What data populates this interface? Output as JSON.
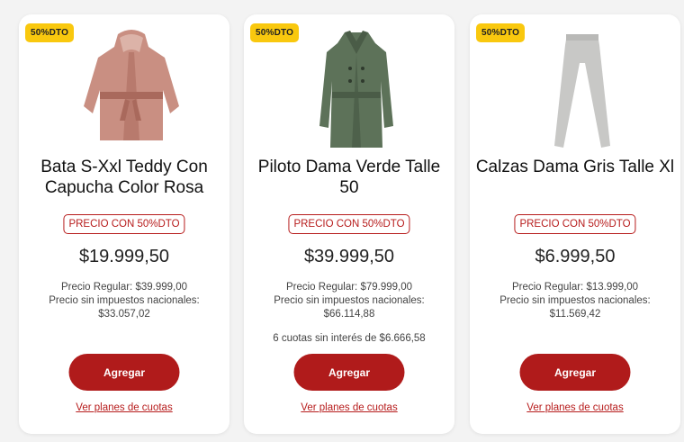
{
  "colors": {
    "accent": "#b01b1b",
    "badge": "#f9c80e",
    "card": "#ffffff"
  },
  "products": [
    {
      "badge": "50%DTO",
      "image_icon": "bathrobe-image",
      "title": "Bata S-Xxl Teddy Con Capucha Color Rosa",
      "promo_label": "PRECIO CON 50%DTO",
      "price": "$19.999,50",
      "regular_price": "Precio Regular: $39.999,00",
      "tax_free_label": "Precio sin impuestos nacionales:",
      "tax_free_value": "$33.057,02",
      "installments": "",
      "add_button": "Agregar",
      "plans_link": "Ver planes de cuotas"
    },
    {
      "badge": "50%DTO",
      "image_icon": "trench-coat-image",
      "title": "Piloto Dama Verde Talle 50",
      "promo_label": "PRECIO CON 50%DTO",
      "price": "$39.999,50",
      "regular_price": "Precio Regular: $79.999,00",
      "tax_free_label": "Precio sin impuestos nacionales:",
      "tax_free_value": "$66.114,88",
      "installments": "6 cuotas sin interés de $6.666,58",
      "add_button": "Agregar",
      "plans_link": "Ver planes de cuotas"
    },
    {
      "badge": "50%DTO",
      "image_icon": "leggings-image",
      "title": "Calzas Dama Gris Talle Xl",
      "promo_label": "PRECIO CON 50%DTO",
      "price": "$6.999,50",
      "regular_price": "Precio Regular: $13.999,00",
      "tax_free_label": "Precio sin impuestos nacionales:",
      "tax_free_value": "$11.569,42",
      "installments": "",
      "add_button": "Agregar",
      "plans_link": "Ver planes de cuotas"
    }
  ]
}
